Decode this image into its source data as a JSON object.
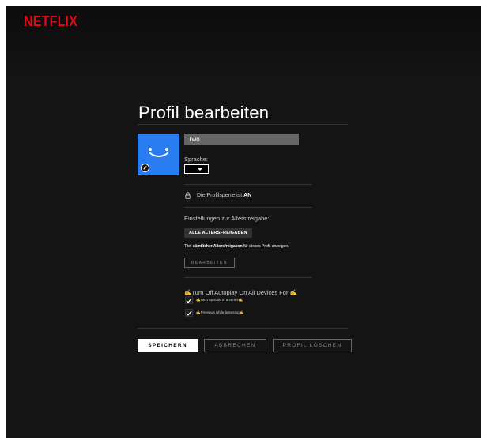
{
  "brand": {
    "logo": "NETFLIX",
    "color": "#e50914"
  },
  "page": {
    "title": "Profil bearbeiten"
  },
  "profile": {
    "avatar_color": "#2a7df1",
    "name_value": "Two",
    "language_label": "Sprache:",
    "language_value": ""
  },
  "lock": {
    "prefix": "Die Profilsperre ist ",
    "state": "AN"
  },
  "maturity": {
    "heading": "Einstellungen zur Altersfreigabe:",
    "badge": "ALLE ALTERSFREIGABEN",
    "desc_prefix": "Titel ",
    "desc_bold": "sämtlicher Altersfreigaben",
    "desc_suffix": " für dieses Profil anzeigen.",
    "edit_button": "BEARBEITEN"
  },
  "autoplay": {
    "heading": "✍Turn Off Autoplay On All Devices For:✍",
    "options": [
      {
        "label": "✍Next episode in a series✍",
        "checked": true
      },
      {
        "label": "✍Previews while browsing✍",
        "checked": true
      }
    ]
  },
  "actions": {
    "save": "SPEICHERN",
    "cancel": "ABBRECHEN",
    "delete": "PROFIL LÖSCHEN"
  },
  "icons": [
    "pencil-icon",
    "lock-icon",
    "caret-down-icon",
    "check-icon"
  ]
}
